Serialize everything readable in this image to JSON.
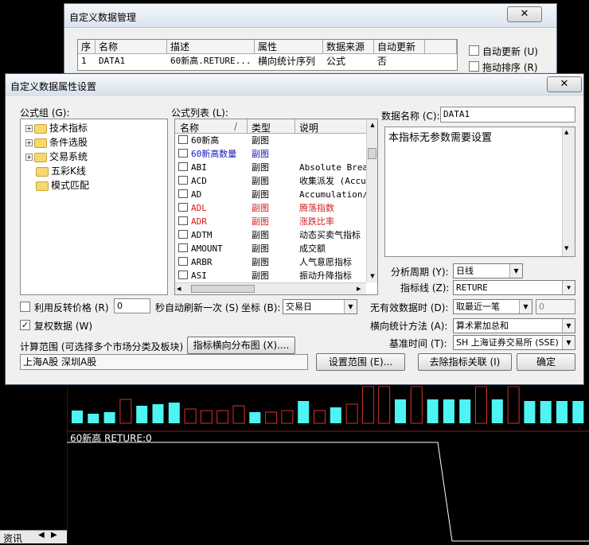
{
  "colors": {
    "bar_cyan": "#4ef4f4",
    "bar_red": "#d9322b",
    "link_blue": "#1515b8",
    "formula_red": "#d42020"
  },
  "chart": {
    "indicator_label": "60新高 RETURE:0"
  },
  "back_window": {
    "title": "自定义数据管理",
    "columns": [
      "序",
      "名称",
      "描述",
      "属性",
      "数据来源",
      "自动更新"
    ],
    "row": [
      "1",
      "DATA1",
      "60新高.RETURE...",
      "横向统计序列",
      "公式",
      "否"
    ],
    "auto_update_label": "自动更新 (U)",
    "drag_sort_label": "拖动排序 (R)"
  },
  "dialog": {
    "title": "自定义数据属性设置",
    "formula_group_label": "公式组 (G):",
    "tree": [
      "技术指标",
      "条件选股",
      "交易系统",
      "五彩K线",
      "模式匹配"
    ],
    "formula_list_label": "公式列表 (L):",
    "list_headers": [
      "名称",
      "/",
      "类型",
      "说明"
    ],
    "formulas": [
      {
        "name": "60新高",
        "type": "副图",
        "desc": ""
      },
      {
        "name": "60新高数量",
        "type": "副图",
        "desc": ""
      },
      {
        "name": "ABI",
        "type": "副图",
        "desc": "Absolute Bread"
      },
      {
        "name": "ACD",
        "type": "副图",
        "desc": "收集派发 (Accu"
      },
      {
        "name": "AD",
        "type": "副图",
        "desc": "Accumulation/D"
      },
      {
        "name": "ADL",
        "type": "副图",
        "desc": "腾落指数"
      },
      {
        "name": "ADR",
        "type": "副图",
        "desc": "涨跌比率"
      },
      {
        "name": "ADTM",
        "type": "副图",
        "desc": "动态买卖气指标"
      },
      {
        "name": "AMOUNT",
        "type": "副图",
        "desc": "成交额"
      },
      {
        "name": "ARBR",
        "type": "副图",
        "desc": "人气意愿指标"
      },
      {
        "name": "ASI",
        "type": "副图",
        "desc": "振动升降指标"
      }
    ],
    "data_name_label": "数据名称 (C):",
    "data_name_value": "DATA1",
    "desc_text": "本指标无参数需要设置",
    "period_label": "分析周期 (Y):",
    "period_value": "日线",
    "line_label": "指标线 (Z):",
    "line_value": "RETURE",
    "use_reverse_label": "利用反转价格 (R)",
    "refresh_value": "0",
    "refresh_label": "秒自动刷新一次 (S)",
    "axis_label": "坐标 (B):",
    "axis_value": "交易日",
    "invalid_label": "无有效数据时 (D):",
    "invalid_value": "取最近一笔",
    "invalid_num": "0",
    "adjusted_label": "复权数据 (W)",
    "stat_method_label": "横向统计方法 (A):",
    "stat_method_value": "算术累加总和",
    "calc_range_label": "计算范围 (可选择多个市场分类及板块)",
    "dist_button": "指标横向分布图 (X)....",
    "range_text": "上海A股  深圳A股",
    "base_time_label": "基准时间 (T):",
    "base_time_value": "SH 上海证券交易所 (SSE)",
    "set_range_button": "设置范围 (E)...",
    "remove_link_button": "去除指标关联 (I)",
    "ok_button": "确定"
  },
  "bottom_tab": "资讯"
}
